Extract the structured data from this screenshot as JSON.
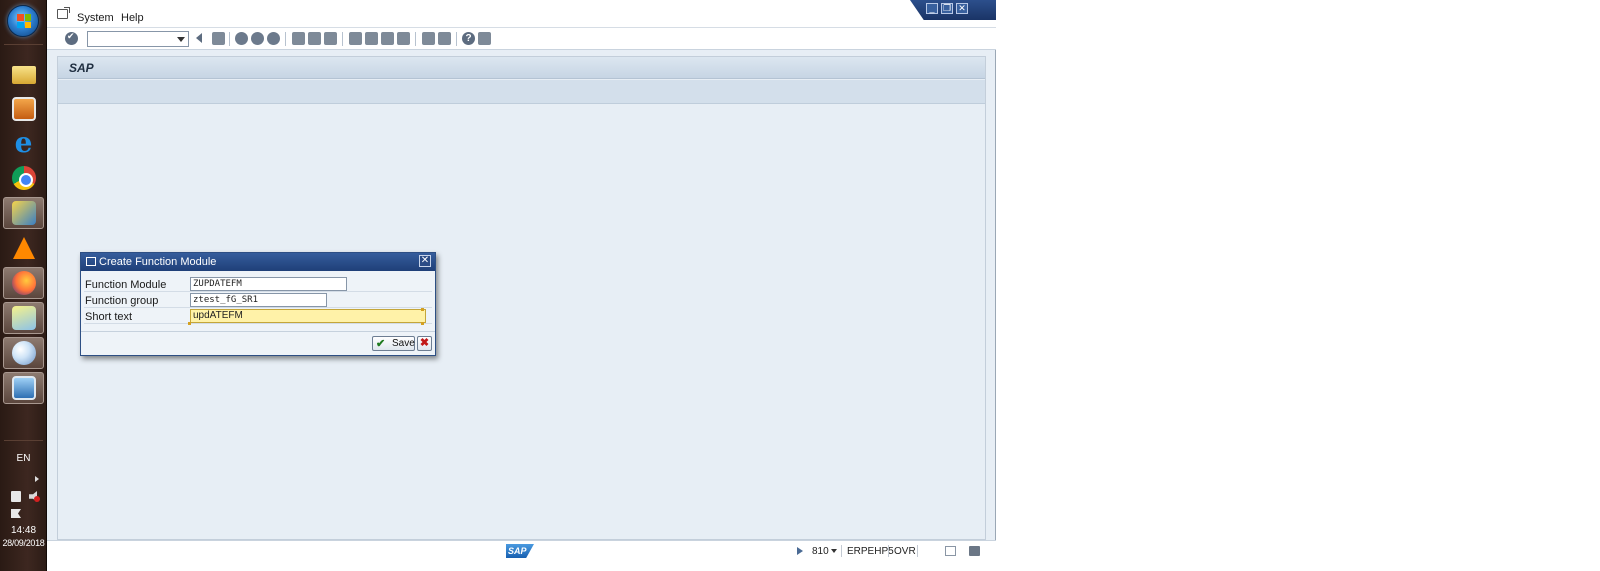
{
  "taskbar": {
    "language": "EN",
    "time": "14:48",
    "date": "28/09/2018"
  },
  "menu": {
    "system": "System",
    "help": "Help"
  },
  "content": {
    "title": "SAP"
  },
  "dialog": {
    "title": "Create Function Module",
    "fields": [
      {
        "label": "Function Module",
        "value": "ZUPDATEFM"
      },
      {
        "label": "Function group",
        "value": "ztest_fG_SR1"
      },
      {
        "label": "Short text",
        "value": "updATEFM"
      }
    ],
    "save_label": "Save"
  },
  "statusbar": {
    "logo": "SAP",
    "client": "810",
    "system": "ERPEHP5",
    "mode": "OVR"
  },
  "colors": {
    "dialog_title": "#1f3f78",
    "active_field": "#fff2a8",
    "background": "#e7eef5"
  }
}
